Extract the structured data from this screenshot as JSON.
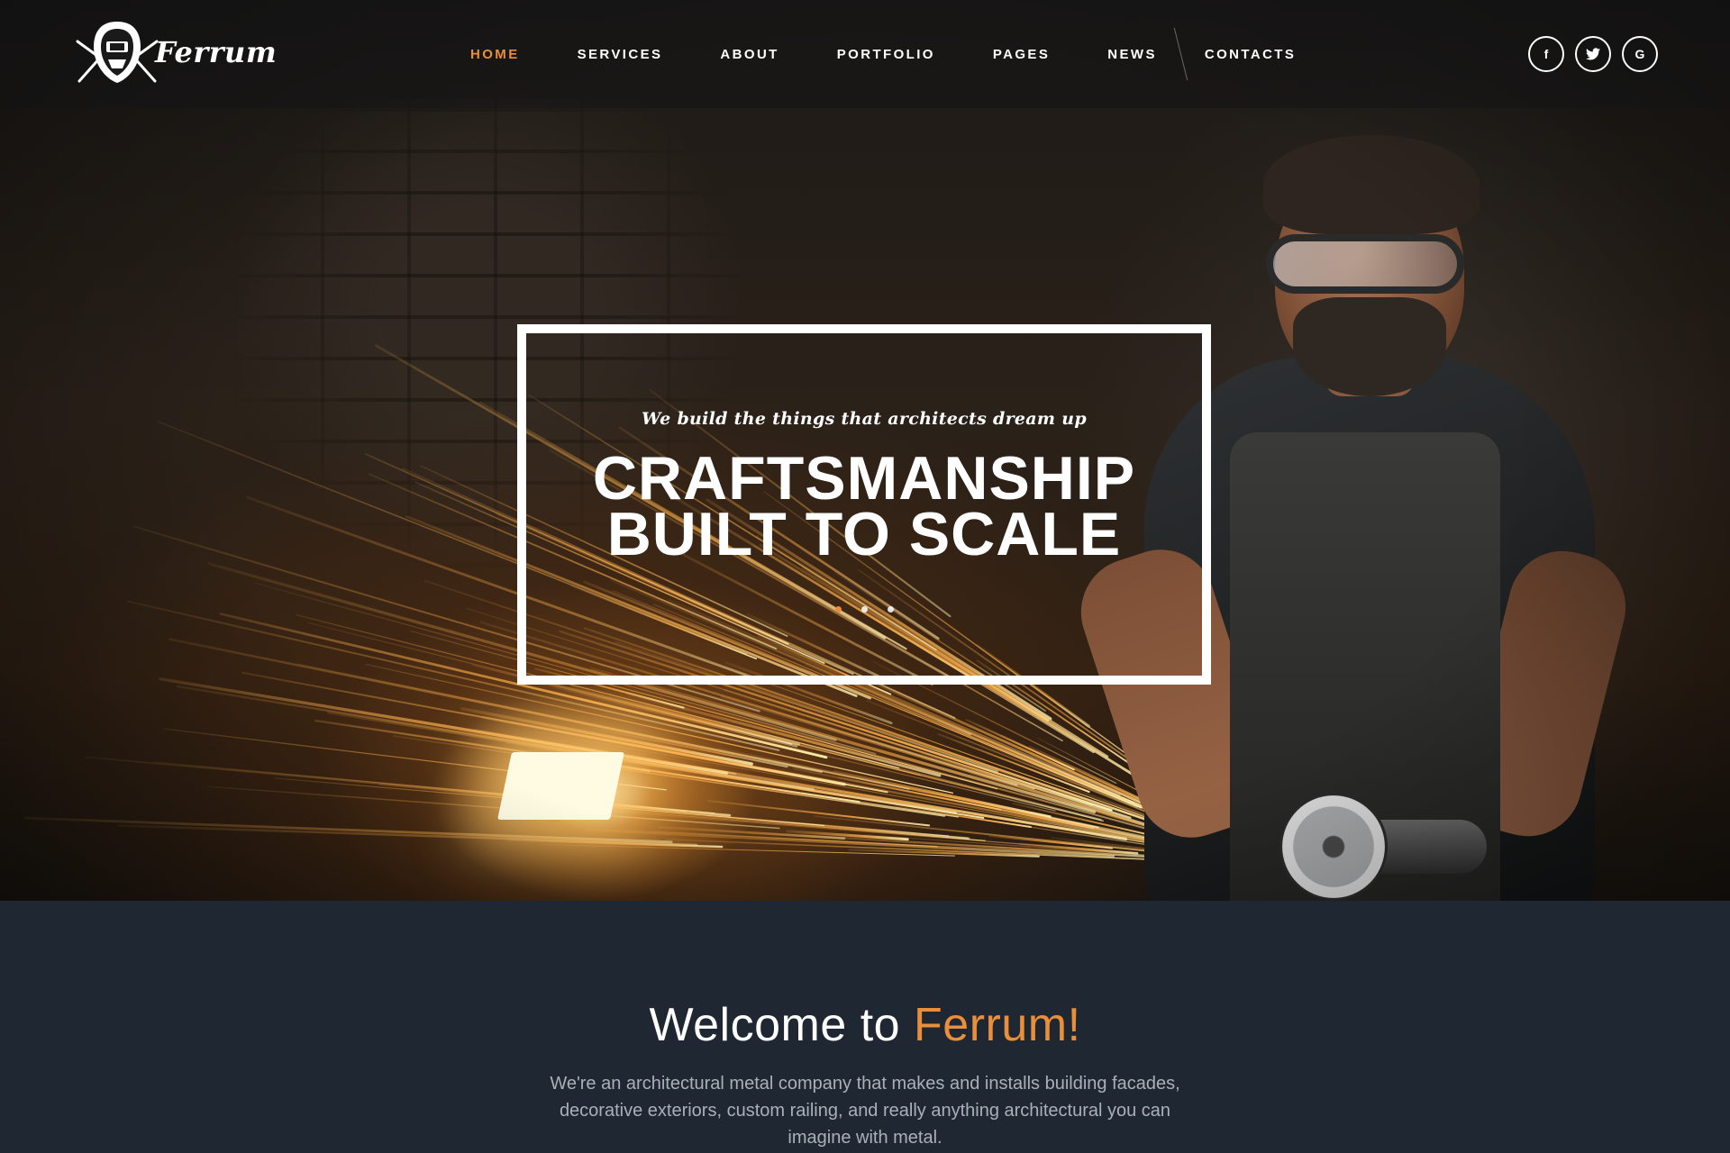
{
  "brand": {
    "name": "Ferrum",
    "logo_icon": "welding-mask-logo"
  },
  "nav": {
    "items": [
      {
        "label": "HOME",
        "active": true
      },
      {
        "label": "SERVICES",
        "active": false
      },
      {
        "label": "ABOUT",
        "active": false
      },
      {
        "label": "PORTFOLIO",
        "active": false
      },
      {
        "label": "PAGES",
        "active": false
      },
      {
        "label": "NEWS",
        "active": false
      },
      {
        "label": "CONTACTS",
        "active": false
      }
    ]
  },
  "socials": [
    {
      "icon": "facebook-icon",
      "glyph": "f"
    },
    {
      "icon": "twitter-icon",
      "glyph": "t"
    },
    {
      "icon": "google-icon",
      "glyph": "G"
    }
  ],
  "hero": {
    "tagline": "We build the things that architects dream up",
    "headline_line1": "CRAFTSMANSHIP",
    "headline_line2": "BUILT TO SCALE",
    "slides_count": 3,
    "active_slide": 1
  },
  "welcome": {
    "title_prefix": "Welcome to ",
    "title_accent": "Ferrum!",
    "text": "We're an architectural metal company that makes and installs building facades, decorative exteriors, custom railing, and really anything architectural you can imagine with metal."
  },
  "colors": {
    "accent": "#e98f3b",
    "background_dark": "#1f2832",
    "text_muted": "#a9b0b8"
  }
}
